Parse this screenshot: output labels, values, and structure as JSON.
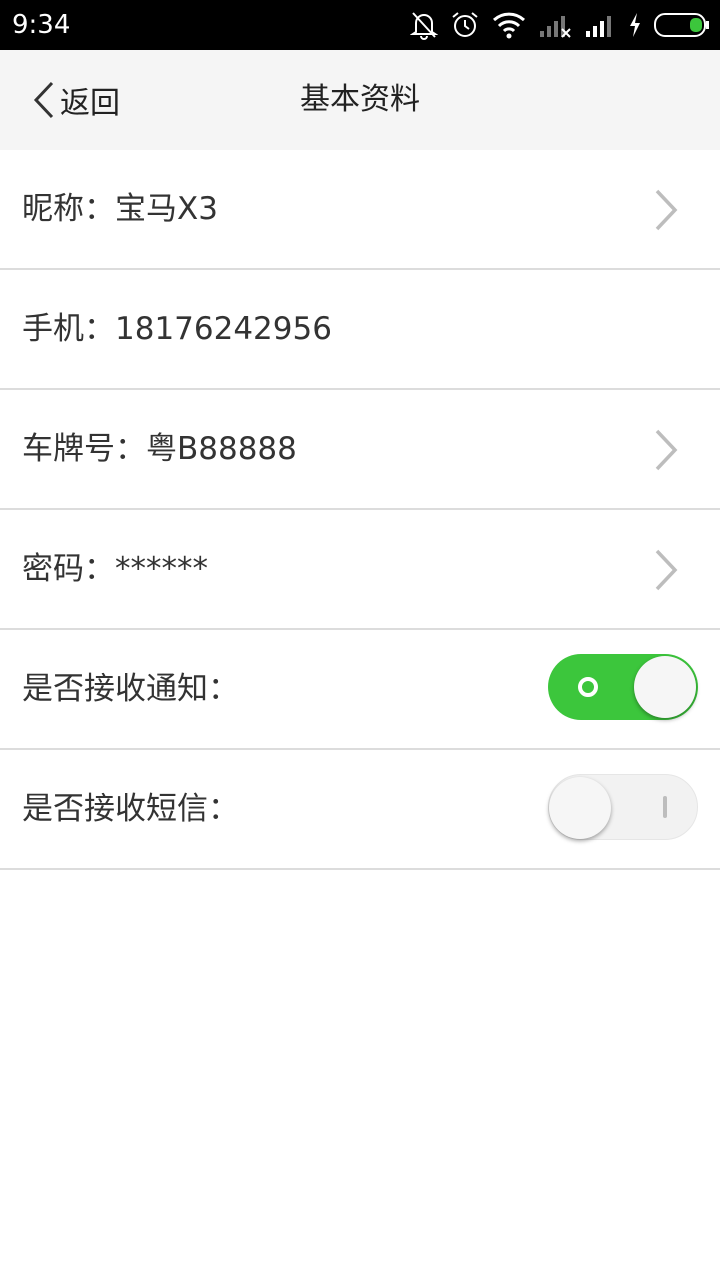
{
  "status_bar": {
    "time": "9:34"
  },
  "nav": {
    "back_label": "返回",
    "title": "基本资料"
  },
  "rows": [
    {
      "label": "昵称：宝马X3",
      "has_chevron": true
    },
    {
      "label": "手机：18176242956",
      "has_chevron": false
    },
    {
      "label": "车牌号：粤B88888",
      "has_chevron": true
    },
    {
      "label": "密码：******",
      "has_chevron": true
    },
    {
      "label": "是否接收通知：",
      "toggle": "on"
    },
    {
      "label": "是否接收短信：",
      "toggle": "off"
    }
  ],
  "colors": {
    "toggle_on": "#3cc63c",
    "status_bar": "#000000",
    "nav_bar": "#f5f5f5",
    "battery": "#3cc63c"
  },
  "icons": {
    "back": "chevron-left-icon",
    "row_arrow": "chevron-right-icon"
  }
}
